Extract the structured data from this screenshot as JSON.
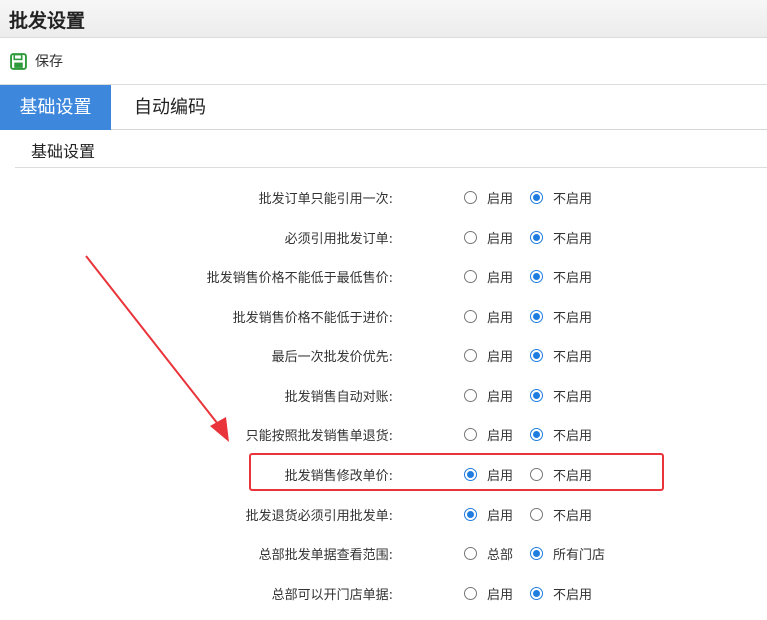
{
  "window": {
    "title": "批发设置"
  },
  "toolbar": {
    "save_label": "保存",
    "save_icon": "floppy-disk-icon",
    "accent": "#2e9b3a"
  },
  "tabs": [
    {
      "label": "基础设置",
      "active": true
    },
    {
      "label": "自动编码",
      "active": false
    }
  ],
  "section": {
    "title": "基础设置"
  },
  "settings": [
    {
      "label": "批发订单只能引用一次:",
      "options": [
        "启用",
        "不启用"
      ],
      "selected": 1
    },
    {
      "label": "必须引用批发订单:",
      "options": [
        "启用",
        "不启用"
      ],
      "selected": 1
    },
    {
      "label": "批发销售价格不能低于最低售价:",
      "options": [
        "启用",
        "不启用"
      ],
      "selected": 1
    },
    {
      "label": "批发销售价格不能低于进价:",
      "options": [
        "启用",
        "不启用"
      ],
      "selected": 1
    },
    {
      "label": "最后一次批发价优先:",
      "options": [
        "启用",
        "不启用"
      ],
      "selected": 1
    },
    {
      "label": "批发销售自动对账:",
      "options": [
        "启用",
        "不启用"
      ],
      "selected": 1
    },
    {
      "label": "只能按照批发销售单退货:",
      "options": [
        "启用",
        "不启用"
      ],
      "selected": 1
    },
    {
      "label": "批发销售修改单价:",
      "options": [
        "启用",
        "不启用"
      ],
      "selected": 0
    },
    {
      "label": "批发退货必须引用批发单:",
      "options": [
        "启用",
        "不启用"
      ],
      "selected": 0
    },
    {
      "label": "总部批发单据查看范围:",
      "options": [
        "总部",
        "所有门店"
      ],
      "selected": 1
    },
    {
      "label": "总部可以开门店单据:",
      "options": [
        "启用",
        "不启用"
      ],
      "selected": 1
    }
  ],
  "colors": {
    "tab_active": "#3d87dc",
    "radio_checked": "#1f7de0",
    "annotation": "#e8343a"
  }
}
